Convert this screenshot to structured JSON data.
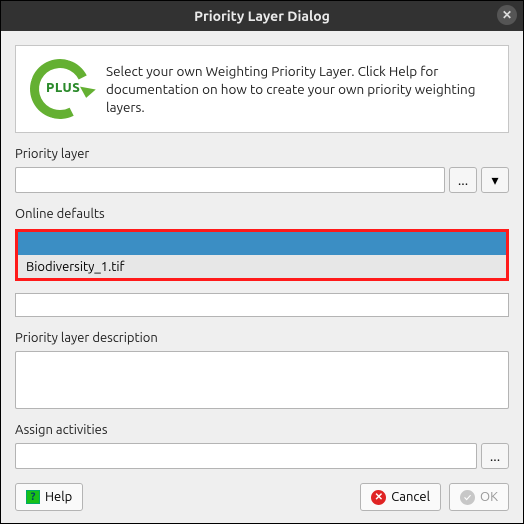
{
  "titlebar": {
    "title": "Priority Layer Dialog"
  },
  "info": {
    "logo_text": "PLUS",
    "description": "Select your own Weighting Priority Layer. Click Help for documentation on how to create your own priority weighting layers."
  },
  "fields": {
    "priority_layer": {
      "label": "Priority layer",
      "value": "",
      "browse_glyph": "...",
      "dropdown_glyph": "▾"
    },
    "online_defaults": {
      "label": "Online defaults",
      "items": [
        {
          "label": "",
          "selected": true
        },
        {
          "label": "Biodiversity_1.tif",
          "selected": false
        }
      ]
    },
    "description": {
      "label": "Priority layer description",
      "value": ""
    },
    "assign": {
      "label": "Assign activities",
      "value": "",
      "browse_glyph": "..."
    }
  },
  "buttons": {
    "help": "Help",
    "cancel": "Cancel",
    "ok": "OK"
  }
}
